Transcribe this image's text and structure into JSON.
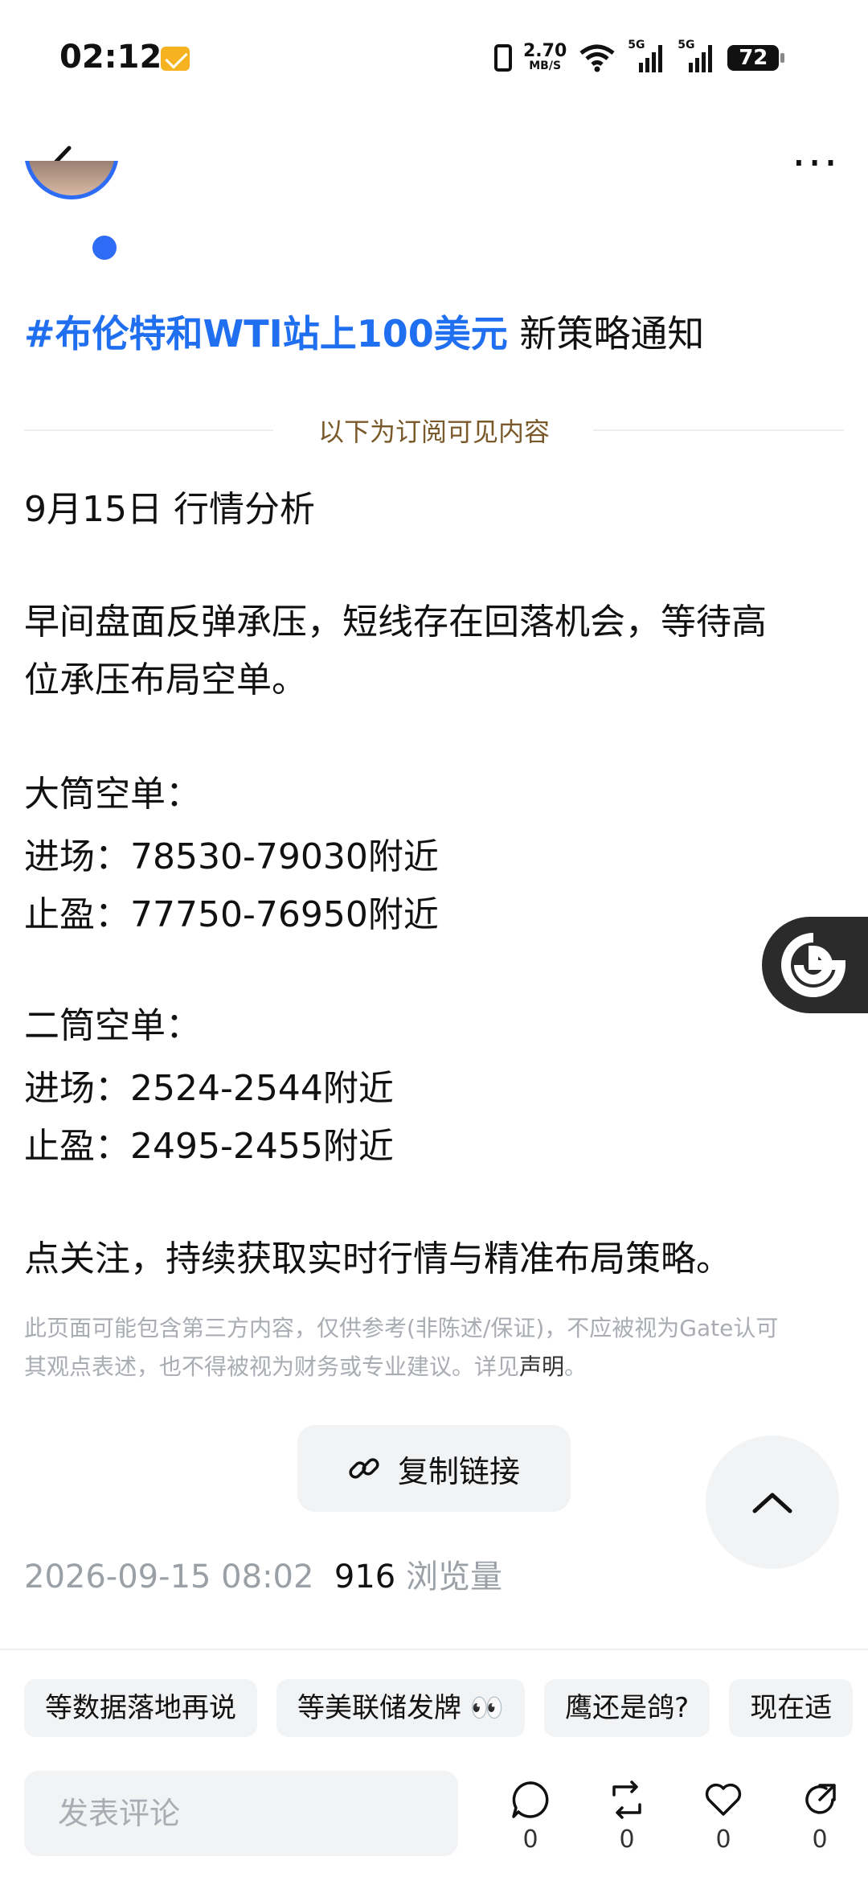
{
  "status_bar": {
    "time": "02:12",
    "speed": "2.70",
    "speed_unit": "MB/S",
    "sig1": "5G",
    "sig2": "5G",
    "battery": "72"
  },
  "post": {
    "tag": "#布伦特和WTI站上100美元",
    "title_rest": "新策略通知",
    "subscriber_divider": "以下为订阅可见内容",
    "lines": [
      "9月15日 行情分析",
      "早间盘面反弹承压，短线存在回落机会，等待高",
      "位承压布局空单。",
      "大筒空单：",
      "进场：78530-79030附近",
      "止盈：77750-76950附近",
      "二筒空单：",
      "进场：2524-2544附近",
      "止盈：2495-2455附近",
      "点关注，持续获取实时行情与精准布局策略。"
    ],
    "disclaimer_line1": "此页面可能包含第三方内容，仅供参考(非陈述/保证)，不应被视为Gate认可",
    "disclaimer_line2": "其观点表述，也不得被视为财务或专业建议。详见",
    "disclaimer_link": "声明",
    "disclaimer_end": "。",
    "copy_link_label": "复制链接",
    "date": "2026-09-15 08:02",
    "views": "916",
    "views_label": "浏览量"
  },
  "chips": [
    "等数据落地再说",
    "等美联储发牌 👀",
    "鹰还是鸽?",
    "现在适"
  ],
  "comment_placeholder": "发表评论",
  "actions": {
    "comment": "0",
    "repost": "0",
    "like": "0",
    "share": "0"
  },
  "colors": {
    "tag": "#1f6ff0",
    "divider_text": "#7a5a2a"
  }
}
